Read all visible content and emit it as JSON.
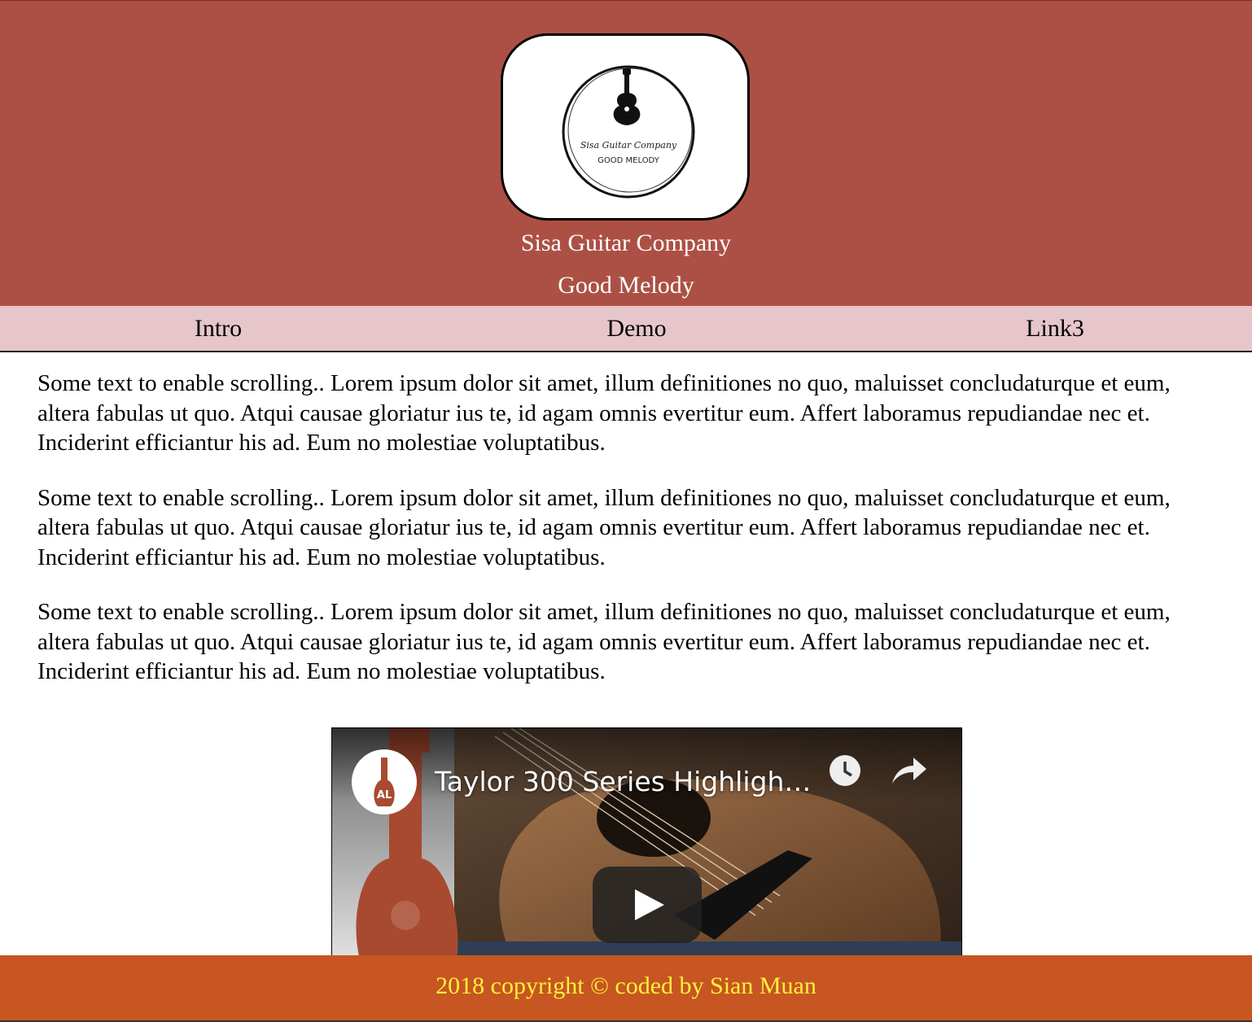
{
  "header": {
    "logo": {
      "icon": "guitar-icon",
      "text_line1": "Sisa Guitar Company",
      "text_line2": "GOOD MELODY"
    },
    "brand_name": "Sisa Guitar Company",
    "tagline": "Good Melody"
  },
  "nav": {
    "items": [
      {
        "label": "Intro"
      },
      {
        "label": "Demo"
      },
      {
        "label": "Link3"
      }
    ]
  },
  "content": {
    "paragraphs": [
      "Some text to enable scrolling.. Lorem ipsum dolor sit amet, illum definitiones no quo, maluisset concludaturque et eum, altera fabulas ut quo. Atqui causae gloriatur ius te, id agam omnis evertitur eum. Affert laboramus repudiandae nec et. Inciderint efficiantur his ad. Eum no molestiae voluptatibus.",
      "Some text to enable scrolling.. Lorem ipsum dolor sit amet, illum definitiones no quo, maluisset concludaturque et eum, altera fabulas ut quo. Atqui causae gloriatur ius te, id agam omnis evertitur eum. Affert laboramus repudiandae nec et. Inciderint efficiantur his ad. Eum no molestiae voluptatibus.",
      "Some text to enable scrolling.. Lorem ipsum dolor sit amet, illum definitiones no quo, maluisset concludaturque et eum, altera fabulas ut quo. Atqui causae gloriatur ius te, id agam omnis evertitur eum. Affert laboramus repudiandae nec et. Inciderint efficiantur his ad. Eum no molestiae voluptatibus."
    ]
  },
  "video": {
    "title": "Taylor 300 Series Highlight …",
    "channel_initials": "AL",
    "icons": [
      "watch-later-icon",
      "share-icon",
      "play-icon"
    ]
  },
  "footer": {
    "text": "2018 copyright © coded by Sian Muan"
  },
  "colors": {
    "header_bg": "#ac5045",
    "nav_bg": "#e6c6ca",
    "footer_bg": "#c75622",
    "footer_text": "#ffef3a"
  }
}
